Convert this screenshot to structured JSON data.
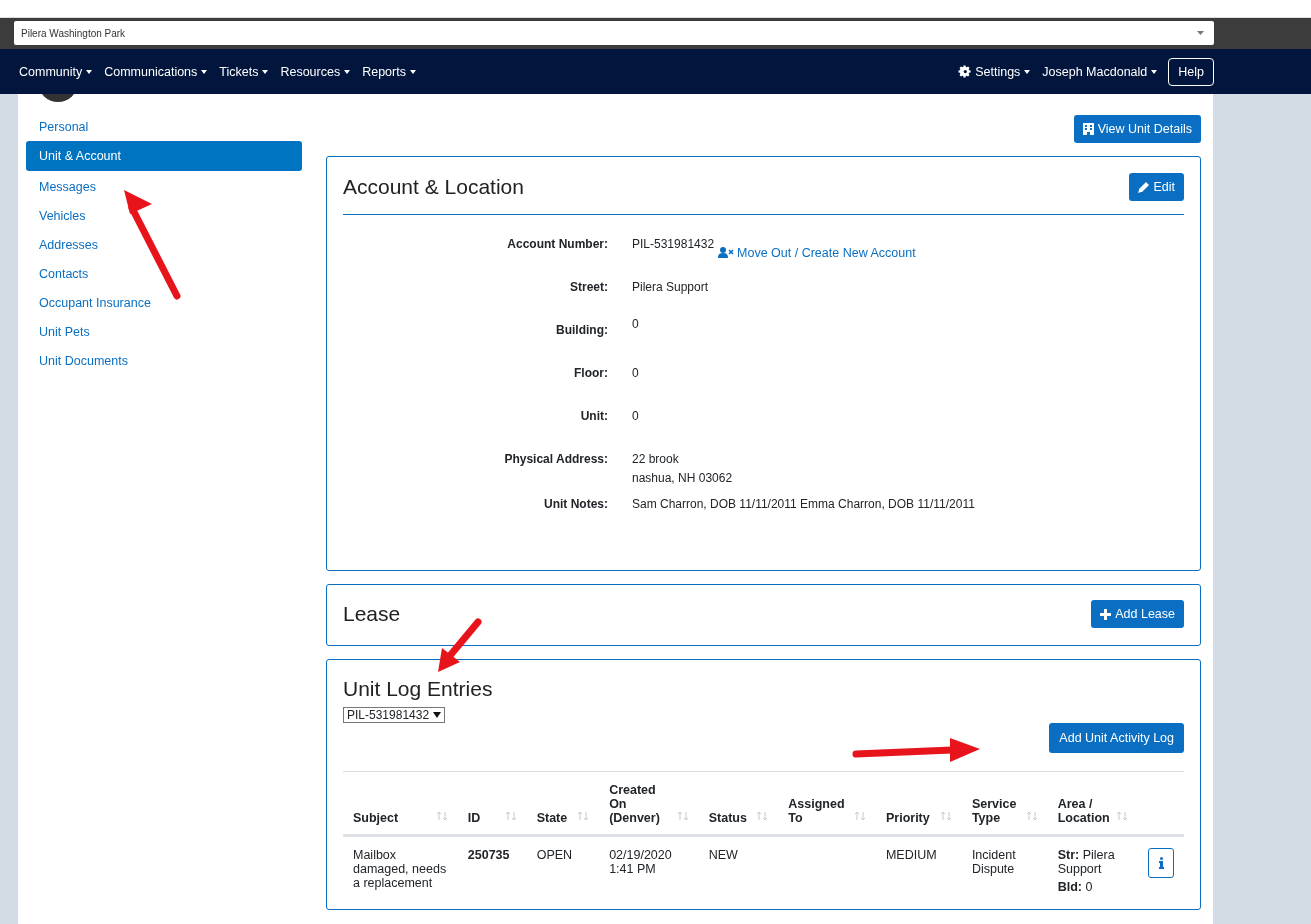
{
  "community_select": {
    "value": "Pilera Washington Park"
  },
  "nav": {
    "menus": [
      "Community",
      "Communications",
      "Tickets",
      "Resources",
      "Reports"
    ],
    "settings": "Settings",
    "user": "Joseph Macdonald",
    "help": "Help"
  },
  "sidebar": {
    "items": [
      {
        "label": "Personal",
        "selected": false
      },
      {
        "label": "Unit & Account",
        "selected": true
      },
      {
        "label": "Messages",
        "selected": false
      },
      {
        "label": "Vehicles",
        "selected": false
      },
      {
        "label": "Addresses",
        "selected": false
      },
      {
        "label": "Contacts",
        "selected": false
      },
      {
        "label": "Occupant Insurance",
        "selected": false
      },
      {
        "label": "Unit Pets",
        "selected": false
      },
      {
        "label": "Unit Documents",
        "selected": false
      }
    ]
  },
  "view_unit_button": "View Unit Details",
  "account_card": {
    "title": "Account & Location",
    "edit_button": "Edit",
    "move_out_link": "Move Out / Create New Account",
    "fields": [
      {
        "label": "Account Number:",
        "lines": [
          "PIL-531981432"
        ],
        "kind": "account"
      },
      {
        "label": "Street:",
        "lines": [
          "Pilera Support"
        ],
        "kind": "text"
      },
      {
        "label": "Building:",
        "lines": [
          "0"
        ],
        "kind": "raised"
      },
      {
        "label": "Floor:",
        "lines": [
          "0"
        ],
        "kind": "text"
      },
      {
        "label": "Unit:",
        "lines": [
          "0"
        ],
        "kind": "text"
      },
      {
        "label": "Physical Address:",
        "lines": [
          "22 brook",
          "nashua, NH 03062"
        ],
        "kind": "text"
      },
      {
        "label": "Unit Notes:",
        "lines": [
          "Sam Charron, DOB 11/11/2011 Emma Charron, DOB 11/11/2011"
        ],
        "kind": "text"
      }
    ]
  },
  "lease_card": {
    "title": "Lease",
    "add_button": "Add Lease"
  },
  "log_card": {
    "title": "Unit Log Entries",
    "account_select": "PIL-531981432",
    "add_button": "Add Unit Activity Log",
    "table": {
      "columns": [
        "Subject",
        "ID",
        "State",
        "Created On (Denver)",
        "Status",
        "Assigned To",
        "Priority",
        "Service Type",
        "Area / Location"
      ],
      "rows": [
        {
          "cells": [
            "Mailbox damaged, needs a replacement",
            "250735",
            "OPEN",
            "02/19/2020 1:41 PM",
            "NEW",
            "",
            "MEDIUM",
            "Incident Dispute"
          ],
          "location": [
            "**Str:** Pilera Support",
            "**Bld:** 0"
          ]
        }
      ]
    }
  }
}
